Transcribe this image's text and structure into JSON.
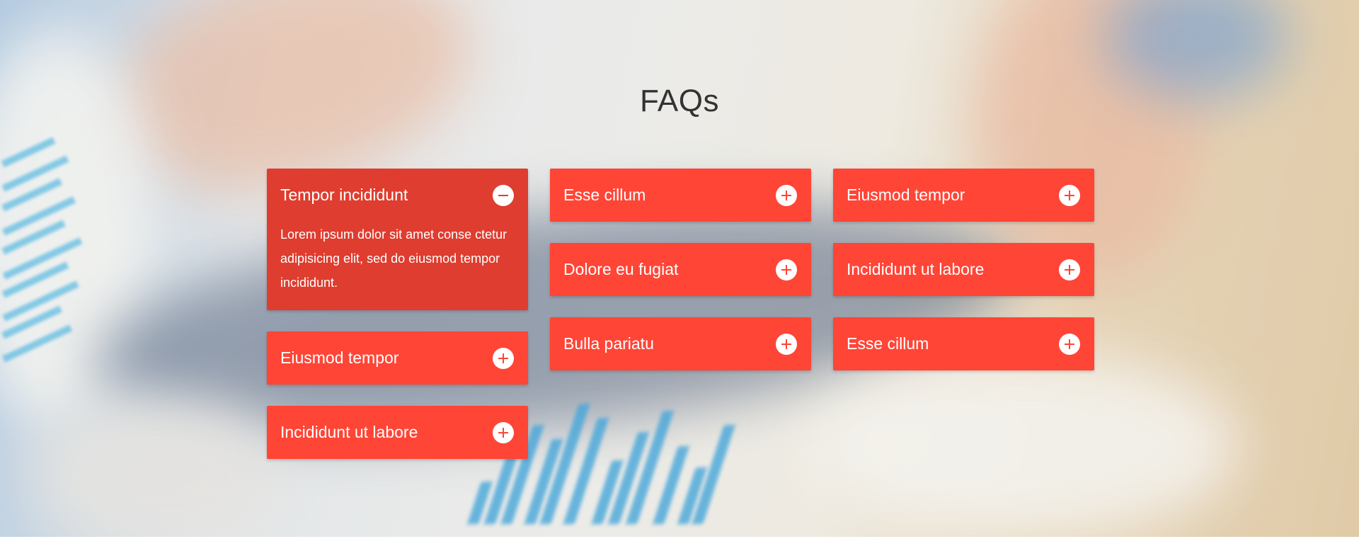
{
  "section": {
    "title": "FAQs"
  },
  "colors": {
    "accent": "#ff4536",
    "accent_open": "#de3d2f",
    "title": "#333333"
  },
  "columns": [
    [
      {
        "question": "Tempor incididunt",
        "expanded": true,
        "icon": "minus-circle-icon",
        "answer": "Lorem ipsum dolor sit amet conse ctetur adipisicing elit, sed do eiusmod tempor incididunt."
      },
      {
        "question": "Eiusmod tempor",
        "expanded": false,
        "icon": "plus-circle-icon"
      },
      {
        "question": "Incididunt ut labore",
        "expanded": false,
        "icon": "plus-circle-icon"
      }
    ],
    [
      {
        "question": "Esse cillum",
        "expanded": false,
        "icon": "plus-circle-icon"
      },
      {
        "question": "Dolore eu fugiat",
        "expanded": false,
        "icon": "plus-circle-icon"
      },
      {
        "question": "Bulla pariatu",
        "expanded": false,
        "icon": "plus-circle-icon"
      }
    ],
    [
      {
        "question": "Eiusmod tempor",
        "expanded": false,
        "icon": "plus-circle-icon"
      },
      {
        "question": "Incididunt ut labore",
        "expanded": false,
        "icon": "plus-circle-icon"
      },
      {
        "question": "Esse cillum",
        "expanded": false,
        "icon": "plus-circle-icon"
      }
    ]
  ]
}
